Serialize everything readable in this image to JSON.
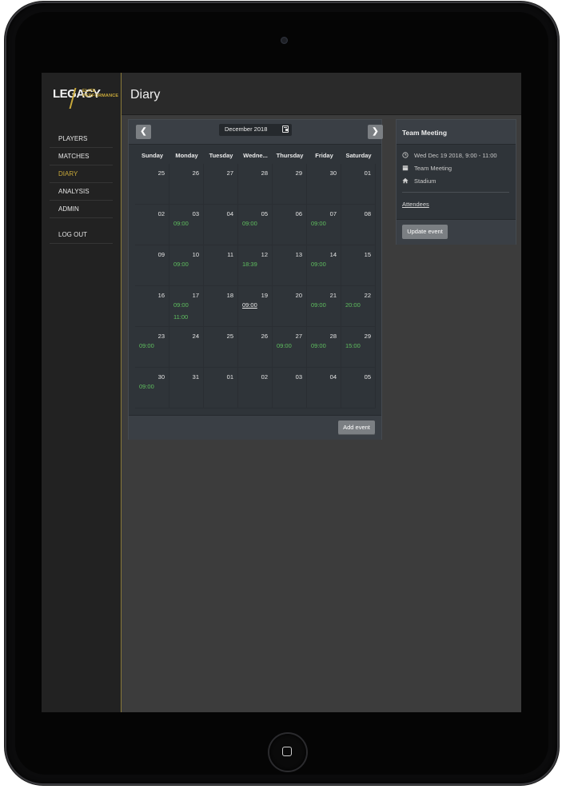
{
  "sidebar": {
    "logo_main": "LEGACY",
    "logo_sub_1": "ELITE",
    "logo_sub_2": "PERFORMANCE",
    "items": [
      {
        "label": "PLAYERS",
        "active": false
      },
      {
        "label": "MATCHES",
        "active": false
      },
      {
        "label": "DIARY",
        "active": true
      },
      {
        "label": "ANALYSIS",
        "active": false
      },
      {
        "label": "ADMIN",
        "active": false
      }
    ],
    "logout_label": "LOG OUT"
  },
  "header": {
    "title": "Diary"
  },
  "calendar": {
    "month_label": "December 2018",
    "prev_icon": "chevron-left-icon",
    "next_icon": "chevron-right-icon",
    "weekdays": [
      "Sunday",
      "Monday",
      "Tuesday",
      "Wedne...",
      "Thursday",
      "Friday",
      "Saturday"
    ],
    "weeks": [
      [
        {
          "day": "25",
          "events": []
        },
        {
          "day": "26",
          "events": []
        },
        {
          "day": "27",
          "events": []
        },
        {
          "day": "28",
          "events": []
        },
        {
          "day": "29",
          "events": []
        },
        {
          "day": "30",
          "events": []
        },
        {
          "day": "01",
          "events": []
        }
      ],
      [
        {
          "day": "02",
          "events": []
        },
        {
          "day": "03",
          "events": [
            "09:00"
          ]
        },
        {
          "day": "04",
          "events": []
        },
        {
          "day": "05",
          "events": [
            "09:00"
          ]
        },
        {
          "day": "06",
          "events": []
        },
        {
          "day": "07",
          "events": [
            "09:00"
          ]
        },
        {
          "day": "08",
          "events": []
        }
      ],
      [
        {
          "day": "09",
          "events": []
        },
        {
          "day": "10",
          "events": [
            "09:00"
          ]
        },
        {
          "day": "11",
          "events": []
        },
        {
          "day": "12",
          "events": [
            "18:39"
          ]
        },
        {
          "day": "13",
          "events": []
        },
        {
          "day": "14",
          "events": [
            "09:00"
          ]
        },
        {
          "day": "15",
          "events": []
        }
      ],
      [
        {
          "day": "16",
          "events": []
        },
        {
          "day": "17",
          "events": [
            "09:00",
            "11:00"
          ]
        },
        {
          "day": "18",
          "events": []
        },
        {
          "day": "19",
          "events": [
            "09:00"
          ],
          "selected": true
        },
        {
          "day": "20",
          "events": []
        },
        {
          "day": "21",
          "events": [
            "09:00"
          ]
        },
        {
          "day": "22",
          "events": [
            "20:00"
          ]
        }
      ],
      [
        {
          "day": "23",
          "events": [
            "09:00"
          ]
        },
        {
          "day": "24",
          "events": []
        },
        {
          "day": "25",
          "events": []
        },
        {
          "day": "26",
          "events": []
        },
        {
          "day": "27",
          "events": [
            "09:00"
          ]
        },
        {
          "day": "28",
          "events": [
            "09:00"
          ]
        },
        {
          "day": "29",
          "events": [
            "15:00"
          ]
        }
      ],
      [
        {
          "day": "30",
          "events": [
            "09:00"
          ]
        },
        {
          "day": "31",
          "events": []
        },
        {
          "day": "01",
          "events": []
        },
        {
          "day": "02",
          "events": []
        },
        {
          "day": "03",
          "events": []
        },
        {
          "day": "04",
          "events": []
        },
        {
          "day": "05",
          "events": []
        }
      ]
    ],
    "add_event_label": "Add event"
  },
  "event": {
    "title": "Team Meeting",
    "datetime": "Wed Dec 19 2018, 9:00 - 11:00",
    "type": "Team Meeting",
    "location": "Stadium",
    "attendees_label": "Attendees",
    "update_label": "Update event"
  },
  "colors": {
    "accent": "#c9a93a",
    "event_green": "#5fbf5f",
    "background": "#3c3c3c",
    "sidebar": "#222222"
  }
}
